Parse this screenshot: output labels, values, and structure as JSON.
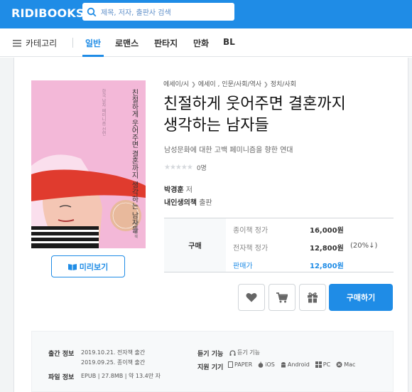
{
  "header": {
    "logo": "RIDIBOOKS",
    "search_placeholder": "제목, 저자, 출판사 검색"
  },
  "nav": {
    "category": "카테고리",
    "tabs": [
      {
        "label": "일반",
        "active": true
      },
      {
        "label": "로맨스",
        "active": false
      },
      {
        "label": "판타지",
        "active": false
      },
      {
        "label": "만화",
        "active": false
      },
      {
        "label": "BL",
        "active": false
      }
    ]
  },
  "cover": {
    "title_text": "친절하게 웃어주면 결혼까지 생각하는 남자들",
    "subtitle_text": "한국 남자 페미니즘 선언",
    "publisher_text": "내인생의책"
  },
  "preview_label": "미리보기",
  "book": {
    "breadcrumb": [
      "에세이/시",
      "에세이 , ",
      "인문/사회/역사",
      "정치/사회"
    ],
    "title_line1": "친절하게 웃어주면 결혼까지",
    "title_line2": "생각하는 남자들",
    "subtitle": "남성문화에 대한 고백 페미니즘을 향한 연대",
    "rating_count": "0명",
    "author_name": "박경훈",
    "author_role": "저",
    "publisher_name": "내인생의책",
    "publisher_role": "출판"
  },
  "price": {
    "label": "구매",
    "rows": [
      {
        "key": "종이책 정가",
        "value": "16,000원",
        "discount": ""
      },
      {
        "key": "전자책 정가",
        "value": "12,800원",
        "discount": "(20%↓)"
      },
      {
        "key": "판매가",
        "value": "12,800원",
        "discount": ""
      }
    ]
  },
  "actions": {
    "buy_label": "구매하기",
    "icons": [
      "heart-icon",
      "cart-icon",
      "gift-icon"
    ]
  },
  "meta": {
    "pub_label": "출간 정보",
    "pub_line1": "2019.10.21. 전자책 출간",
    "pub_line2": "2019.09.25. 종이책 출간",
    "file_label": "파일 정보",
    "file_value": "EPUB | 27.8MB | 약 13.4만 자",
    "listen_label": "듣기 기능",
    "listen_value": "듣기 기능",
    "devices_label": "지원 기기",
    "devices": [
      "PAPER",
      "iOS",
      "Android",
      "PC",
      "Mac"
    ]
  },
  "colors": {
    "brand": "#1f8ce6",
    "cover_pink": "#f3b8d8",
    "cover_red": "#e03b2e"
  }
}
